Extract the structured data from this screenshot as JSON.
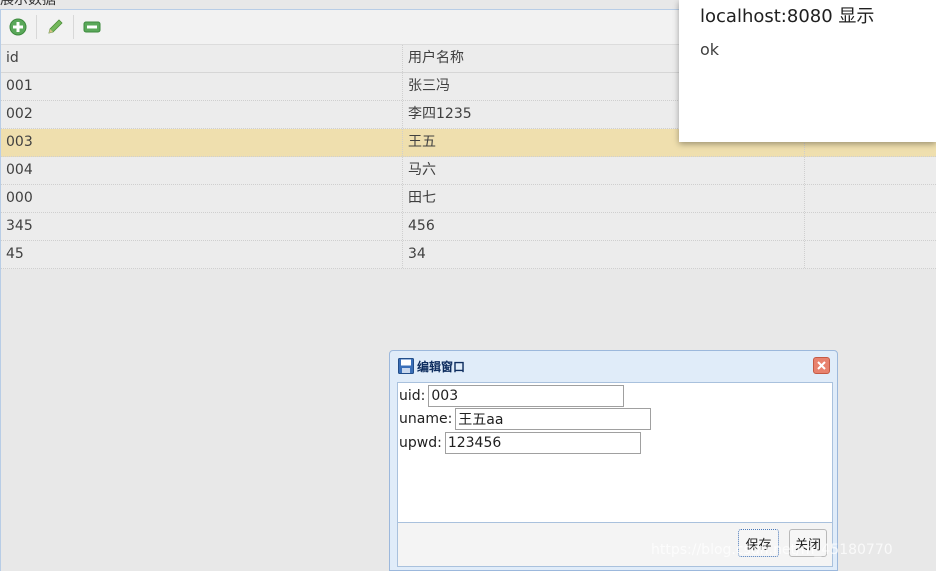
{
  "panel": {
    "title_cut": "展示数据"
  },
  "toolbar": {
    "add_icon": "plus-circle-icon",
    "edit_icon": "pencil-icon",
    "remove_icon": "minus-icon"
  },
  "grid": {
    "columns": [
      "id",
      "用户名称",
      ""
    ],
    "rows": [
      {
        "id": "001",
        "name": "张三冯",
        "extra": ""
      },
      {
        "id": "002",
        "name": "李四1235",
        "extra": ""
      },
      {
        "id": "003",
        "name": "王五",
        "extra": "",
        "selected": true
      },
      {
        "id": "004",
        "name": "马六",
        "extra": ""
      },
      {
        "id": "000",
        "name": "田七",
        "extra": ""
      },
      {
        "id": "345",
        "name": "456",
        "extra": ""
      },
      {
        "id": "45",
        "name": "34",
        "extra": ""
      }
    ]
  },
  "alert": {
    "title": "localhost:8080 显示",
    "message": "ok"
  },
  "dialog": {
    "title": "编辑窗口",
    "fields": {
      "uid": {
        "label": "uid:",
        "value": "003"
      },
      "uname": {
        "label": "uname:",
        "value": "王五aa"
      },
      "upwd": {
        "label": "upwd:",
        "value": "123456"
      }
    },
    "save_label": "保存",
    "close_label": "关闭"
  },
  "watermark": "https://blog.csdn.net/m_45180770",
  "colors": {
    "selected_row": "#efdfae",
    "dialog_header": "#e0ecf9",
    "close_button": "#e8826e"
  }
}
